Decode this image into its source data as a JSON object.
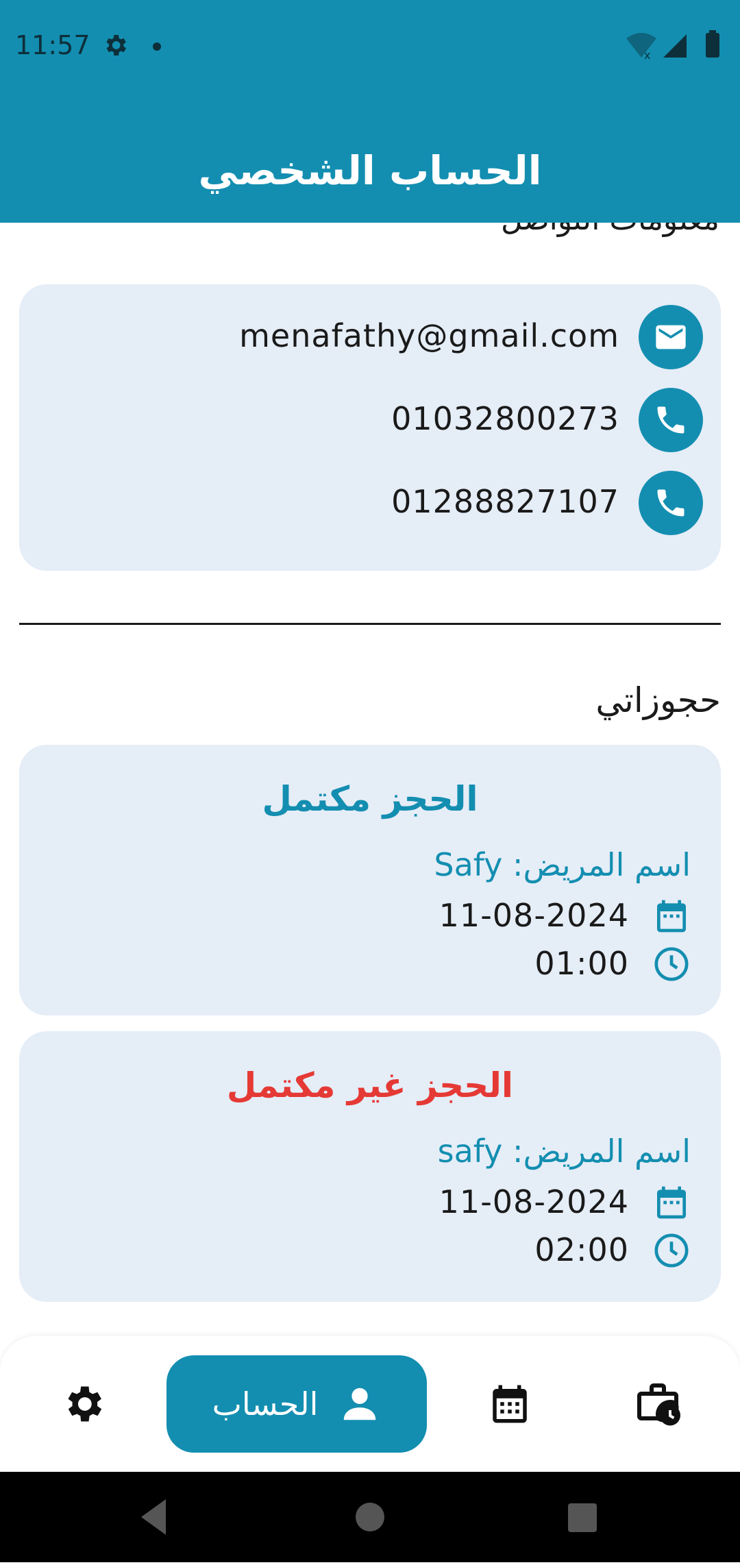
{
  "status_bar": {
    "time": "11:57"
  },
  "app_bar": {
    "title": "الحساب الشخصي"
  },
  "contact": {
    "heading": "معلومات التواصل",
    "email": "menafathy@gmail.com",
    "phone_1": "01032800273",
    "phone_2": "01288827107"
  },
  "bookings": {
    "title": "حجوزاتي",
    "items": [
      {
        "status": "الحجز مكتمل",
        "status_color": "#138eb0",
        "patient": "اسم المريض: Safy",
        "date": "11-08-2024",
        "time": "01:00"
      },
      {
        "status": "الحجز غير مكتمل",
        "status_color": "#e53935",
        "patient": "اسم المريض: safy",
        "date": "11-08-2024",
        "time": "02:00"
      }
    ]
  },
  "nav": {
    "active_label": "الحساب",
    "items": [
      "settings-icon",
      "person-icon",
      "calendar-icon",
      "work-history-icon"
    ]
  },
  "colors": {
    "primary": "#138eb0",
    "card": "#e5edf7",
    "danger": "#e53935"
  }
}
